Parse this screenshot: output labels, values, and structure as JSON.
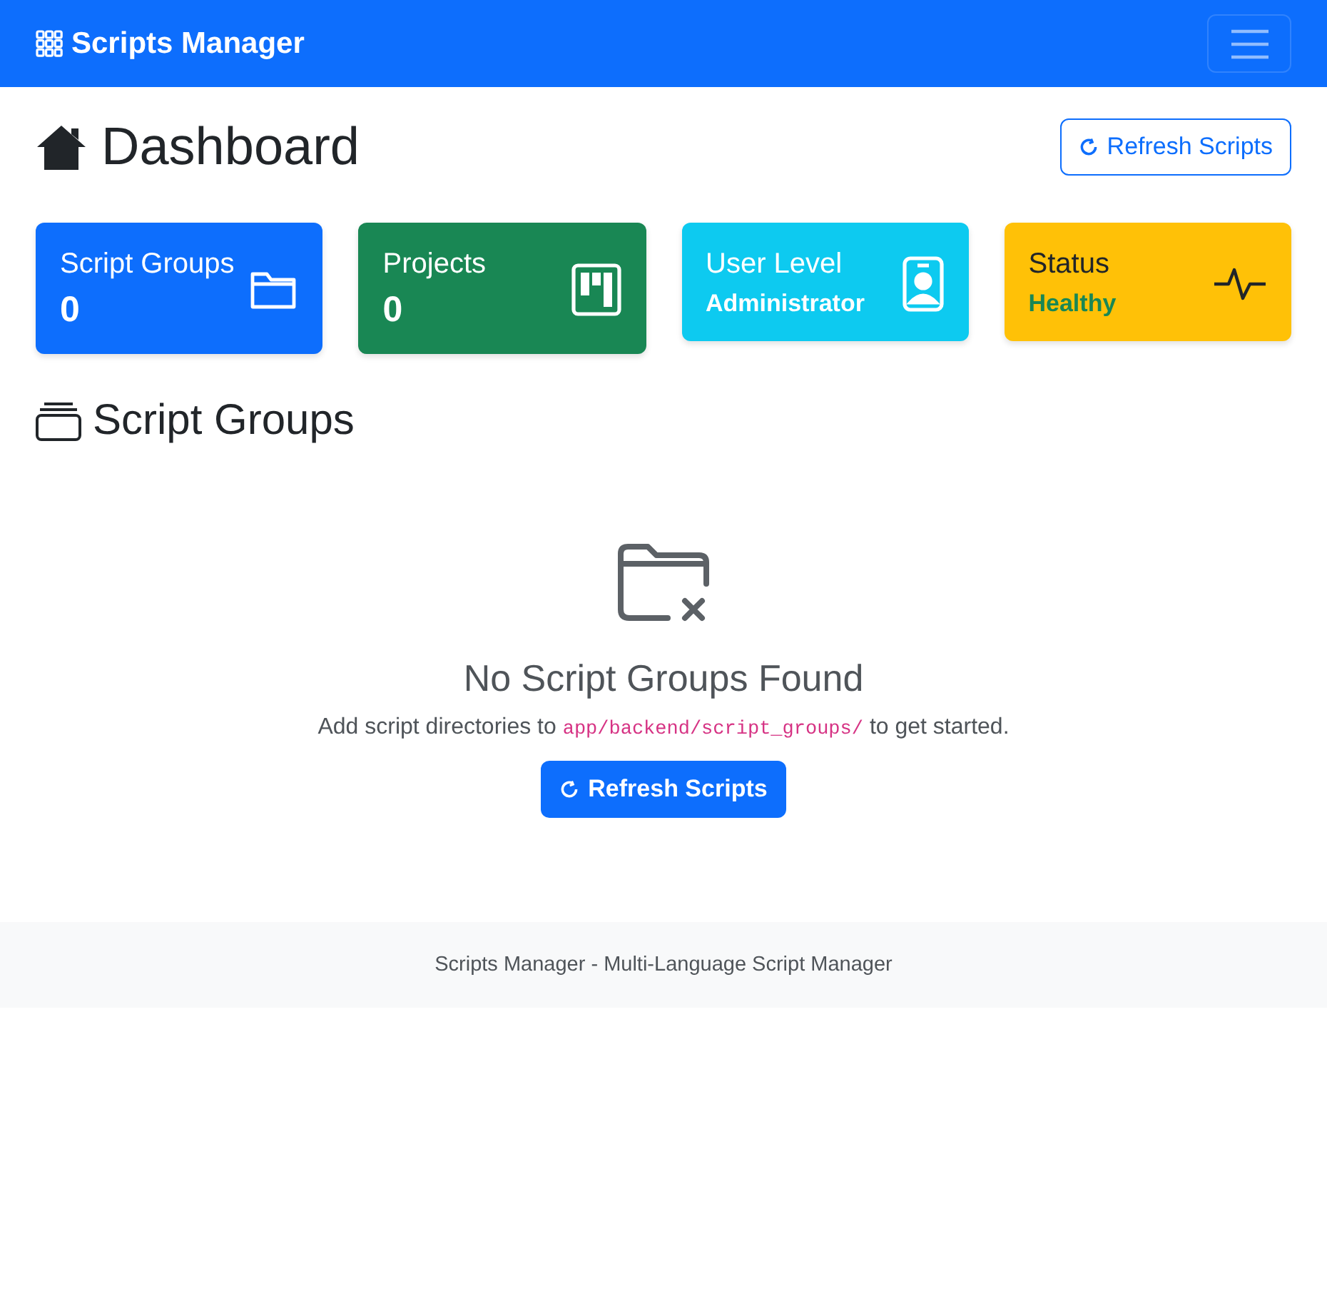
{
  "navbar": {
    "brand": "Scripts Manager",
    "menu_expanded": false
  },
  "header": {
    "title": "Dashboard",
    "button": "Refresh Scripts"
  },
  "stats": [
    {
      "kind": "count",
      "title": "Script Groups",
      "value": "0",
      "color": "#0d6efd"
    },
    {
      "kind": "count",
      "title": "Projects",
      "value": "0",
      "color": "#198754"
    },
    {
      "kind": "text",
      "title": "User Level",
      "value": "Administrator",
      "color": "#0dcaf0"
    },
    {
      "kind": "status",
      "title": "Status",
      "value": "Healthy",
      "color": "#ffc107"
    }
  ],
  "section": {
    "title": "Script Groups"
  },
  "empty_state": {
    "title": "No Script Groups Found",
    "text_before": "Add script directories to",
    "path": "app/backend/script_groups/",
    "text_after": "to get started.",
    "button": "Refresh Scripts"
  },
  "footer": {
    "text": "Scripts Manager - Multi-Language Script Manager"
  }
}
